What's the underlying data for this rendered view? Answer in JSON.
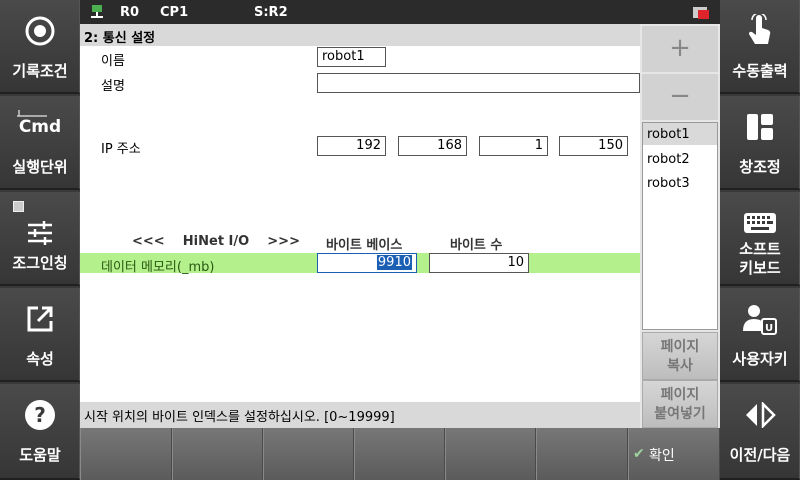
{
  "status": {
    "robot": "R0",
    "program": "CP1",
    "step": "S:R2"
  },
  "left_buttons": [
    {
      "label": "기록조건",
      "icon": "record-circle-icon"
    },
    {
      "label": "실행단위",
      "icon": "cmd-icon",
      "icon_text": "Cmd"
    },
    {
      "label": "조그인칭",
      "icon": "sliders-icon"
    },
    {
      "label": "속성",
      "icon": "external-link-icon"
    },
    {
      "label": "도움말",
      "icon": "help-icon"
    }
  ],
  "right_buttons": [
    {
      "label": "수동출력",
      "icon": "touch-hand-icon"
    },
    {
      "label": "창조정",
      "icon": "window-layout-icon"
    },
    {
      "label1": "소프트",
      "label2": "키보드",
      "icon": "keyboard-icon"
    },
    {
      "label": "사용자키",
      "icon": "user-key-icon"
    },
    {
      "label": "이전/다음",
      "icon": "prev-next-icon"
    }
  ],
  "panel": {
    "title": "2: 통신 설정",
    "name_label": "이름",
    "name_value": "robot1",
    "desc_label": "설명",
    "desc_value": "",
    "ip_label": "IP 주소",
    "ip": [
      "192",
      "168",
      "1",
      "150"
    ],
    "hinet_label": "<<<    HiNet I/O    >>>",
    "col_byte_base": "바이트 베이스",
    "col_byte_count": "바이트 수",
    "row_label": "데이터 메모리(_mb)",
    "byte_base_value": "9910",
    "byte_count_value": "10"
  },
  "list": {
    "plus_label": "+",
    "minus_label": "−",
    "items": [
      "robot1",
      "robot2",
      "robot3"
    ],
    "selected": "robot1",
    "page_copy_1": "페이지",
    "page_copy_2": "복사",
    "page_paste_1": "페이지",
    "page_paste_2": "붙여넣기"
  },
  "hint": "시작 위치의 바이트 인덱스를 설정하십시오. [0~19999]",
  "confirm_label": "확인",
  "colors": {
    "highlight_row": "#b4f08c",
    "selection": "#1a5fb4",
    "alarm": "#e0242b"
  }
}
